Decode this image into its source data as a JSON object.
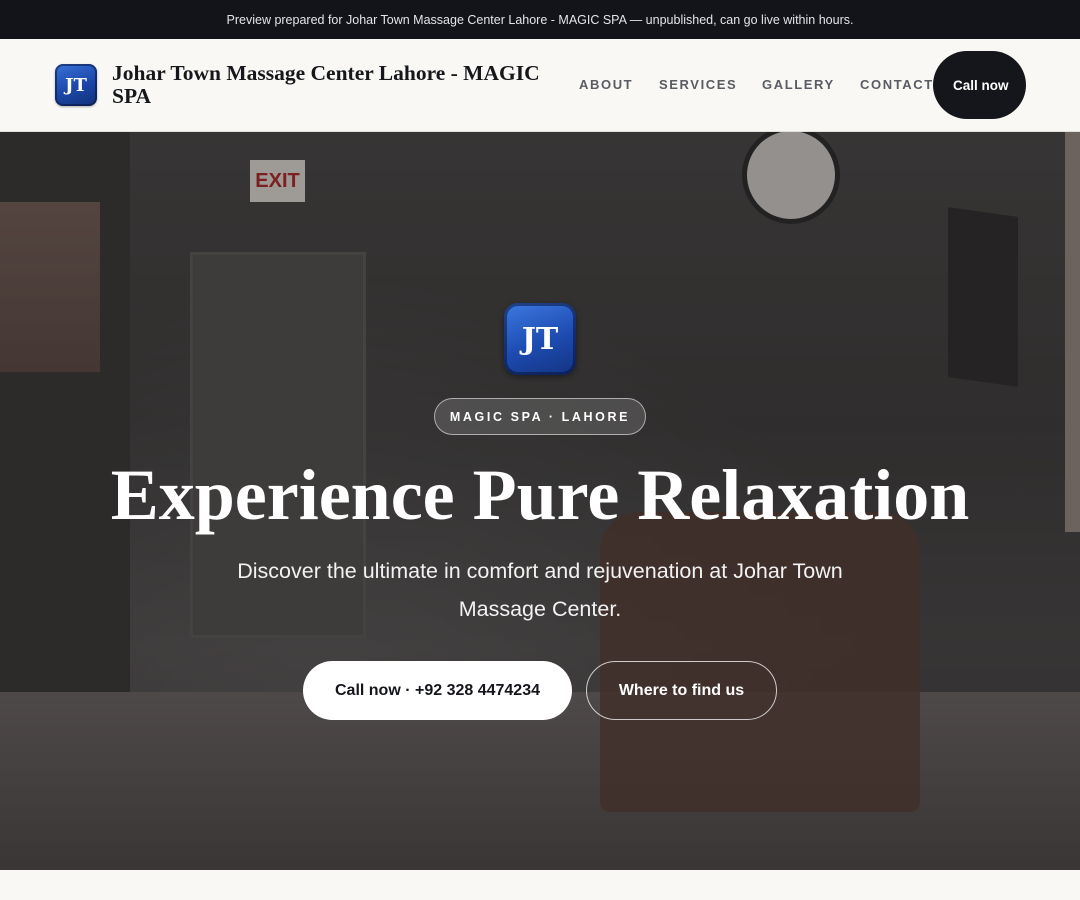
{
  "preview_bar": {
    "text": "Preview prepared for Johar Town Massage Center Lahore - MAGIC SPA — unpublished, can go live within hours."
  },
  "header": {
    "logo_text": "JT",
    "brand_name": "Johar Town Massage Center Lahore - MAGIC SPA",
    "nav": [
      "ABOUT",
      "SERVICES",
      "GALLERY",
      "CONTACT"
    ],
    "call_button": "Call now"
  },
  "hero": {
    "logo_text": "JT",
    "exit_sign": "EXIT",
    "pill": "MAGIC SPA · LAHORE",
    "title": "Experience Pure Relaxation",
    "subtitle": "Discover the ultimate in comfort and rejuvenation at Johar Town Massage Center.",
    "primary_button": "Call now · +92 328 4474234",
    "secondary_button": "Where to find us"
  },
  "colors": {
    "accent_dark": "#15161c",
    "logo_blue": "#1b46a8",
    "page_bg": "#f9f8f5"
  }
}
